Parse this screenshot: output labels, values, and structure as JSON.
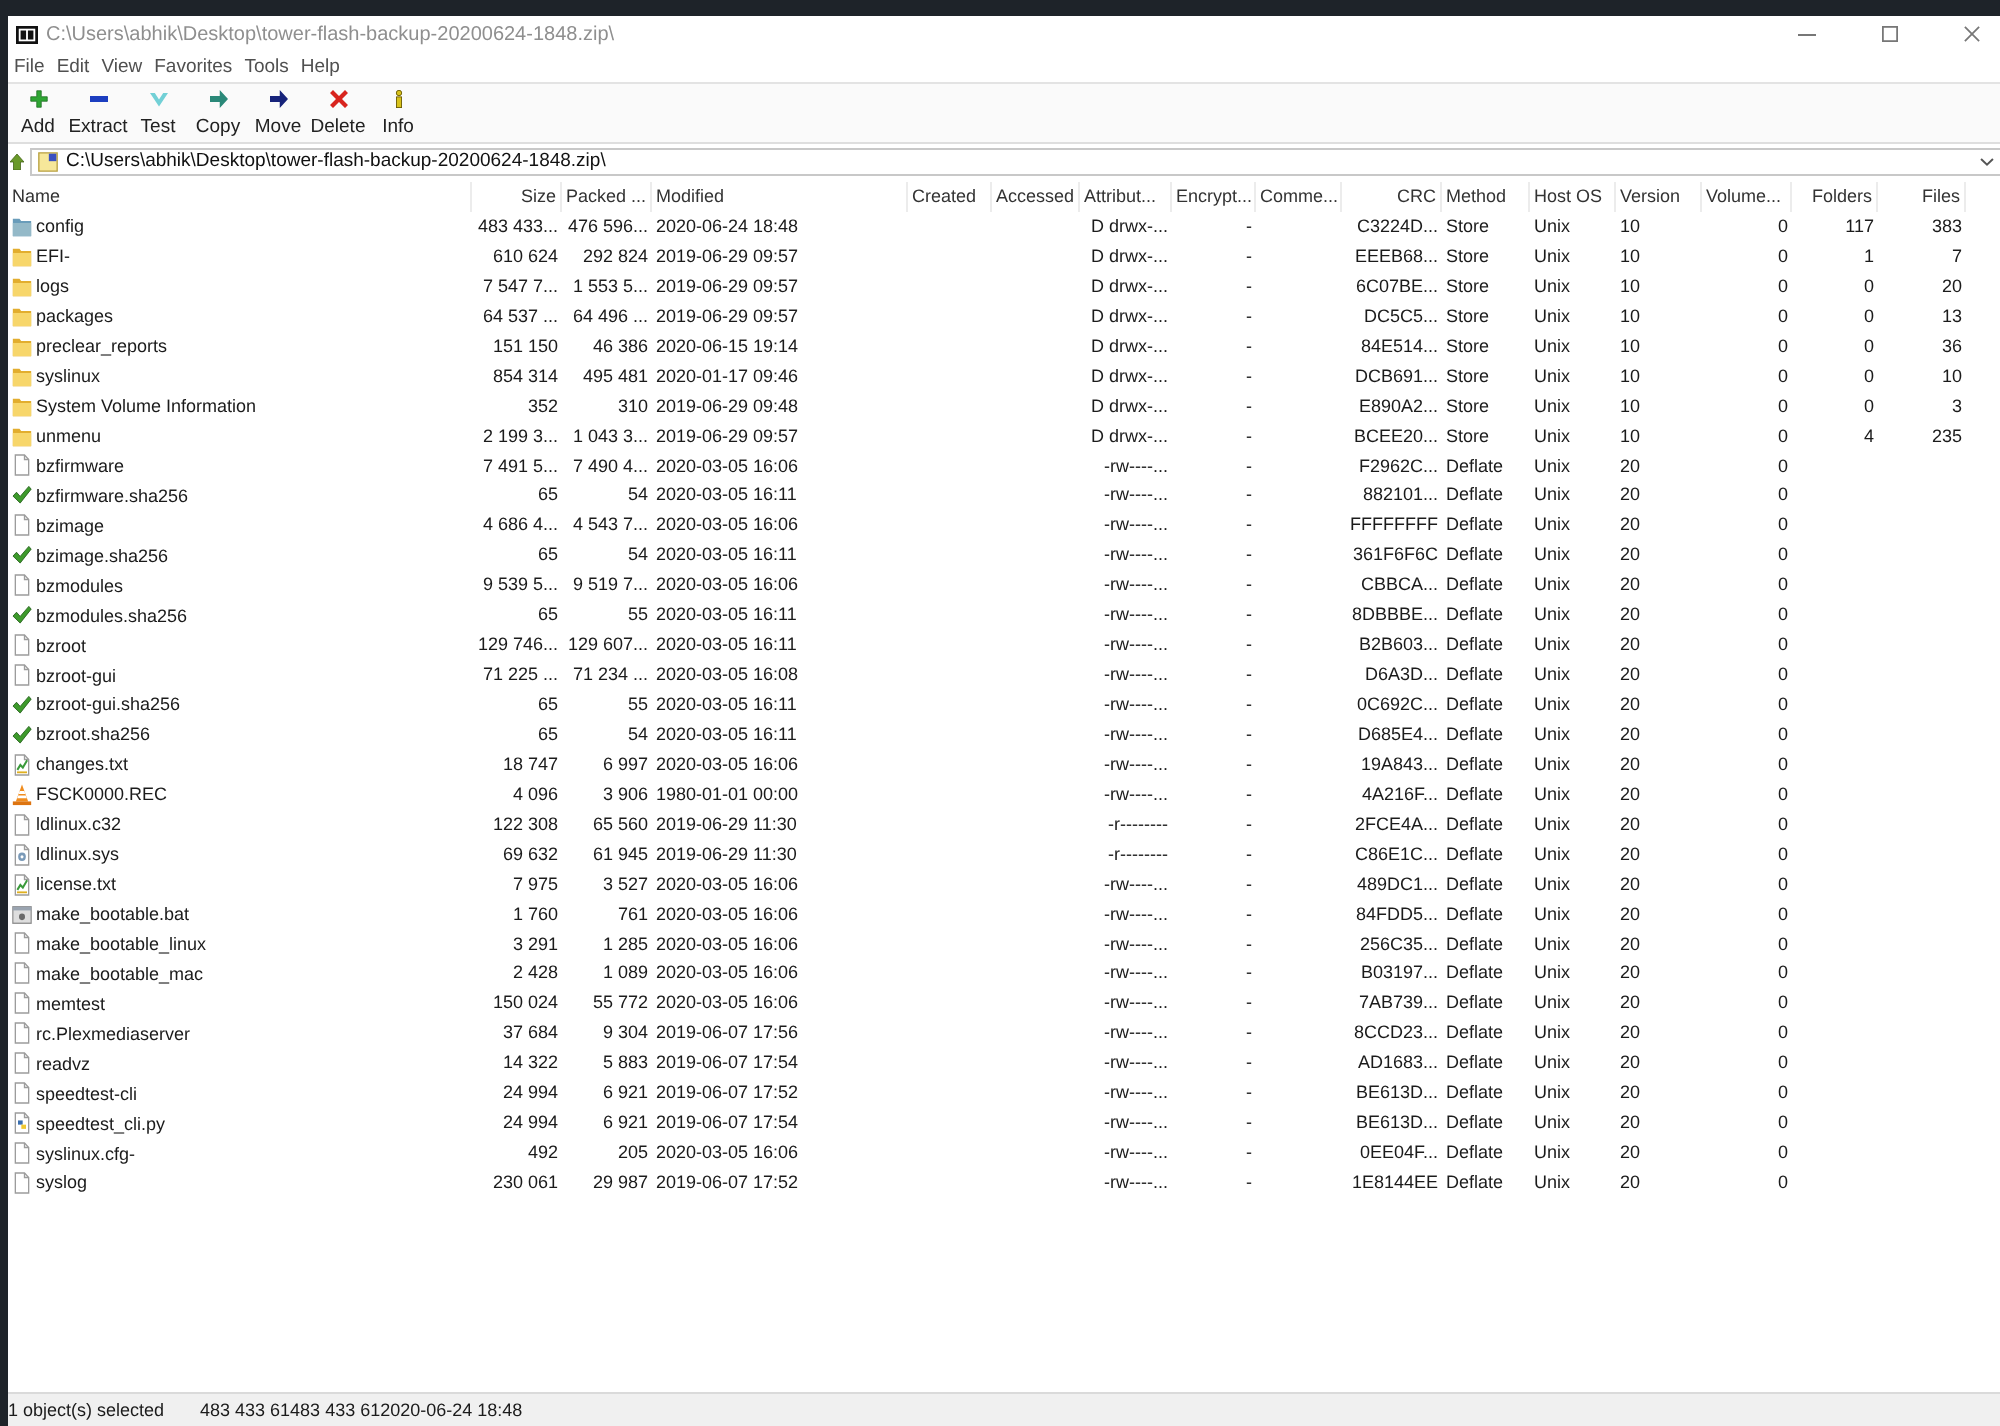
{
  "window": {
    "title": "C:\\Users\\abhik\\Desktop\\tower-flash-backup-20200624-1848.zip\\"
  },
  "menu": [
    "File",
    "Edit",
    "View",
    "Favorites",
    "Tools",
    "Help"
  ],
  "toolbar": [
    "Add",
    "Extract",
    "Test",
    "Copy",
    "Move",
    "Delete",
    "Info"
  ],
  "address_bar": {
    "value": "C:\\Users\\abhik\\Desktop\\tower-flash-backup-20200624-1848.zip\\"
  },
  "table": {
    "columns": [
      "Name",
      "Size",
      "Packed ...",
      "Modified",
      "Created",
      "Accessed",
      "Attribut...",
      "Encrypt...",
      "Comme...",
      "CRC",
      "Method",
      "Host OS",
      "Version",
      "Volume...",
      "Folders",
      "Files"
    ],
    "rows": [
      {
        "name": "config",
        "kind": "folder",
        "selected": true,
        "size": "483 433...",
        "packed": "476 596...",
        "modified": "2020-06-24 18:48",
        "attributes": "D drwx-...",
        "encrypted": "-",
        "crc": "C3224D...",
        "method": "Store",
        "host_os": "Unix",
        "version": "10",
        "volume": "0",
        "folders": "117",
        "files": "383"
      },
      {
        "name": "EFI-",
        "kind": "folder",
        "selected": false,
        "size": "610 624",
        "packed": "292 824",
        "modified": "2019-06-29 09:57",
        "attributes": "D drwx-...",
        "encrypted": "-",
        "crc": "EEEB68...",
        "method": "Store",
        "host_os": "Unix",
        "version": "10",
        "volume": "0",
        "folders": "1",
        "files": "7"
      },
      {
        "name": "logs",
        "kind": "folder",
        "selected": false,
        "size": "7 547 7...",
        "packed": "1 553 5...",
        "modified": "2019-06-29 09:57",
        "attributes": "D drwx-...",
        "encrypted": "-",
        "crc": "6C07BE...",
        "method": "Store",
        "host_os": "Unix",
        "version": "10",
        "volume": "0",
        "folders": "0",
        "files": "20"
      },
      {
        "name": "packages",
        "kind": "folder",
        "selected": false,
        "size": "64 537 ...",
        "packed": "64 496 ...",
        "modified": "2019-06-29 09:57",
        "attributes": "D drwx-...",
        "encrypted": "-",
        "crc": "DC5C5...",
        "method": "Store",
        "host_os": "Unix",
        "version": "10",
        "volume": "0",
        "folders": "0",
        "files": "13"
      },
      {
        "name": "preclear_reports",
        "kind": "folder",
        "selected": false,
        "size": "151 150",
        "packed": "46 386",
        "modified": "2020-06-15 19:14",
        "attributes": "D drwx-...",
        "encrypted": "-",
        "crc": "84E514...",
        "method": "Store",
        "host_os": "Unix",
        "version": "10",
        "volume": "0",
        "folders": "0",
        "files": "36"
      },
      {
        "name": "syslinux",
        "kind": "folder",
        "selected": false,
        "size": "854 314",
        "packed": "495 481",
        "modified": "2020-01-17 09:46",
        "attributes": "D drwx-...",
        "encrypted": "-",
        "crc": "DCB691...",
        "method": "Store",
        "host_os": "Unix",
        "version": "10",
        "volume": "0",
        "folders": "0",
        "files": "10"
      },
      {
        "name": "System Volume Information",
        "kind": "folder",
        "selected": false,
        "size": "352",
        "packed": "310",
        "modified": "2019-06-29 09:48",
        "attributes": "D drwx-...",
        "encrypted": "-",
        "crc": "E890A2...",
        "method": "Store",
        "host_os": "Unix",
        "version": "10",
        "volume": "0",
        "folders": "0",
        "files": "3"
      },
      {
        "name": "unmenu",
        "kind": "folder",
        "selected": false,
        "size": "2 199 3...",
        "packed": "1 043 3...",
        "modified": "2019-06-29 09:57",
        "attributes": "D drwx-...",
        "encrypted": "-",
        "crc": "BCEE20...",
        "method": "Store",
        "host_os": "Unix",
        "version": "10",
        "volume": "0",
        "folders": "4",
        "files": "235"
      },
      {
        "name": "bzfirmware",
        "kind": "file",
        "selected": false,
        "size": "7 491 5...",
        "packed": "7 490 4...",
        "modified": "2020-03-05 16:06",
        "attributes": "-rw----...",
        "encrypted": "-",
        "crc": "F2962C...",
        "method": "Deflate",
        "host_os": "Unix",
        "version": "20",
        "volume": "0"
      },
      {
        "name": "bzfirmware.sha256",
        "kind": "checksum",
        "selected": false,
        "size": "65",
        "packed": "54",
        "modified": "2020-03-05 16:11",
        "attributes": "-rw----...",
        "encrypted": "-",
        "crc": "882101...",
        "method": "Deflate",
        "host_os": "Unix",
        "version": "20",
        "volume": "0"
      },
      {
        "name": "bzimage",
        "kind": "file",
        "selected": false,
        "size": "4 686 4...",
        "packed": "4 543 7...",
        "modified": "2020-03-05 16:06",
        "attributes": "-rw----...",
        "encrypted": "-",
        "crc": "FFFFFFFF",
        "method": "Deflate",
        "host_os": "Unix",
        "version": "20",
        "volume": "0"
      },
      {
        "name": "bzimage.sha256",
        "kind": "checksum",
        "selected": false,
        "size": "65",
        "packed": "54",
        "modified": "2020-03-05 16:11",
        "attributes": "-rw----...",
        "encrypted": "-",
        "crc": "361F6F6C",
        "method": "Deflate",
        "host_os": "Unix",
        "version": "20",
        "volume": "0"
      },
      {
        "name": "bzmodules",
        "kind": "file",
        "selected": false,
        "size": "9 539 5...",
        "packed": "9 519 7...",
        "modified": "2020-03-05 16:06",
        "attributes": "-rw----...",
        "encrypted": "-",
        "crc": "CBBCA...",
        "method": "Deflate",
        "host_os": "Unix",
        "version": "20",
        "volume": "0"
      },
      {
        "name": "bzmodules.sha256",
        "kind": "checksum",
        "selected": false,
        "size": "65",
        "packed": "55",
        "modified": "2020-03-05 16:11",
        "attributes": "-rw----...",
        "encrypted": "-",
        "crc": "8DBBBE...",
        "method": "Deflate",
        "host_os": "Unix",
        "version": "20",
        "volume": "0"
      },
      {
        "name": "bzroot",
        "kind": "file",
        "selected": false,
        "size": "129 746...",
        "packed": "129 607...",
        "modified": "2020-03-05 16:11",
        "attributes": "-rw----...",
        "encrypted": "-",
        "crc": "B2B603...",
        "method": "Deflate",
        "host_os": "Unix",
        "version": "20",
        "volume": "0"
      },
      {
        "name": "bzroot-gui",
        "kind": "file",
        "selected": false,
        "size": "71 225 ...",
        "packed": "71 234 ...",
        "modified": "2020-03-05 16:08",
        "attributes": "-rw----...",
        "encrypted": "-",
        "crc": "D6A3D...",
        "method": "Deflate",
        "host_os": "Unix",
        "version": "20",
        "volume": "0"
      },
      {
        "name": "bzroot-gui.sha256",
        "kind": "checksum",
        "selected": false,
        "size": "65",
        "packed": "55",
        "modified": "2020-03-05 16:11",
        "attributes": "-rw----...",
        "encrypted": "-",
        "crc": "0C692C...",
        "method": "Deflate",
        "host_os": "Unix",
        "version": "20",
        "volume": "0"
      },
      {
        "name": "bzroot.sha256",
        "kind": "checksum",
        "selected": false,
        "size": "65",
        "packed": "54",
        "modified": "2020-03-05 16:11",
        "attributes": "-rw----...",
        "encrypted": "-",
        "crc": "D685E4...",
        "method": "Deflate",
        "host_os": "Unix",
        "version": "20",
        "volume": "0"
      },
      {
        "name": "changes.txt",
        "kind": "text",
        "selected": false,
        "size": "18 747",
        "packed": "6 997",
        "modified": "2020-03-05 16:06",
        "attributes": "-rw----...",
        "encrypted": "-",
        "crc": "19A843...",
        "method": "Deflate",
        "host_os": "Unix",
        "version": "20",
        "volume": "0"
      },
      {
        "name": "FSCK0000.REC",
        "kind": "media",
        "selected": false,
        "size": "4 096",
        "packed": "3 906",
        "modified": "1980-01-01 00:00",
        "attributes": "-rw----...",
        "encrypted": "-",
        "crc": "4A216F...",
        "method": "Deflate",
        "host_os": "Unix",
        "version": "20",
        "volume": "0"
      },
      {
        "name": "ldlinux.c32",
        "kind": "file",
        "selected": false,
        "size": "122 308",
        "packed": "65 560",
        "modified": "2019-06-29 11:30",
        "attributes": "-r--------",
        "encrypted": "-",
        "crc": "2FCE4A...",
        "method": "Deflate",
        "host_os": "Unix",
        "version": "20",
        "volume": "0"
      },
      {
        "name": "ldlinux.sys",
        "kind": "system",
        "selected": false,
        "size": "69 632",
        "packed": "61 945",
        "modified": "2019-06-29 11:30",
        "attributes": "-r--------",
        "encrypted": "-",
        "crc": "C86E1C...",
        "method": "Deflate",
        "host_os": "Unix",
        "version": "20",
        "volume": "0"
      },
      {
        "name": "license.txt",
        "kind": "text",
        "selected": false,
        "size": "7 975",
        "packed": "3 527",
        "modified": "2020-03-05 16:06",
        "attributes": "-rw----...",
        "encrypted": "-",
        "crc": "489DC1...",
        "method": "Deflate",
        "host_os": "Unix",
        "version": "20",
        "volume": "0"
      },
      {
        "name": "make_bootable.bat",
        "kind": "batch",
        "selected": false,
        "size": "1 760",
        "packed": "761",
        "modified": "2020-03-05 16:06",
        "attributes": "-rw----...",
        "encrypted": "-",
        "crc": "84FDD5...",
        "method": "Deflate",
        "host_os": "Unix",
        "version": "20",
        "volume": "0"
      },
      {
        "name": "make_bootable_linux",
        "kind": "file",
        "selected": false,
        "size": "3 291",
        "packed": "1 285",
        "modified": "2020-03-05 16:06",
        "attributes": "-rw----...",
        "encrypted": "-",
        "crc": "256C35...",
        "method": "Deflate",
        "host_os": "Unix",
        "version": "20",
        "volume": "0"
      },
      {
        "name": "make_bootable_mac",
        "kind": "file",
        "selected": false,
        "size": "2 428",
        "packed": "1 089",
        "modified": "2020-03-05 16:06",
        "attributes": "-rw----...",
        "encrypted": "-",
        "crc": "B03197...",
        "method": "Deflate",
        "host_os": "Unix",
        "version": "20",
        "volume": "0"
      },
      {
        "name": "memtest",
        "kind": "file",
        "selected": false,
        "size": "150 024",
        "packed": "55 772",
        "modified": "2020-03-05 16:06",
        "attributes": "-rw----...",
        "encrypted": "-",
        "crc": "7AB739...",
        "method": "Deflate",
        "host_os": "Unix",
        "version": "20",
        "volume": "0"
      },
      {
        "name": "rc.Plexmediaserver",
        "kind": "file",
        "selected": false,
        "size": "37 684",
        "packed": "9 304",
        "modified": "2019-06-07 17:56",
        "attributes": "-rw----...",
        "encrypted": "-",
        "crc": "8CCD23...",
        "method": "Deflate",
        "host_os": "Unix",
        "version": "20",
        "volume": "0"
      },
      {
        "name": "readvz",
        "kind": "file",
        "selected": false,
        "size": "14 322",
        "packed": "5 883",
        "modified": "2019-06-07 17:54",
        "attributes": "-rw----...",
        "encrypted": "-",
        "crc": "AD1683...",
        "method": "Deflate",
        "host_os": "Unix",
        "version": "20",
        "volume": "0"
      },
      {
        "name": "speedtest-cli",
        "kind": "file",
        "selected": false,
        "size": "24 994",
        "packed": "6 921",
        "modified": "2019-06-07 17:52",
        "attributes": "-rw----...",
        "encrypted": "-",
        "crc": "BE613D...",
        "method": "Deflate",
        "host_os": "Unix",
        "version": "20",
        "volume": "0"
      },
      {
        "name": "speedtest_cli.py",
        "kind": "script",
        "selected": false,
        "size": "24 994",
        "packed": "6 921",
        "modified": "2019-06-07 17:54",
        "attributes": "-rw----...",
        "encrypted": "-",
        "crc": "BE613D...",
        "method": "Deflate",
        "host_os": "Unix",
        "version": "20",
        "volume": "0"
      },
      {
        "name": "syslinux.cfg-",
        "kind": "file",
        "selected": false,
        "size": "492",
        "packed": "205",
        "modified": "2020-03-05 16:06",
        "attributes": "-rw----...",
        "encrypted": "-",
        "crc": "0EE04F...",
        "method": "Deflate",
        "host_os": "Unix",
        "version": "20",
        "volume": "0"
      },
      {
        "name": "syslog",
        "kind": "file",
        "selected": false,
        "size": "230 061",
        "packed": "29 987",
        "modified": "2019-06-07 17:52",
        "attributes": "-rw----...",
        "encrypted": "-",
        "crc": "1E8144EE",
        "method": "Deflate",
        "host_os": "Unix",
        "version": "20",
        "volume": "0"
      }
    ]
  },
  "status_bar": {
    "text": "1 object(s) selected",
    "panes": [
      "483 433 61",
      "483 433 61",
      "2020-06-24 18:48"
    ]
  }
}
